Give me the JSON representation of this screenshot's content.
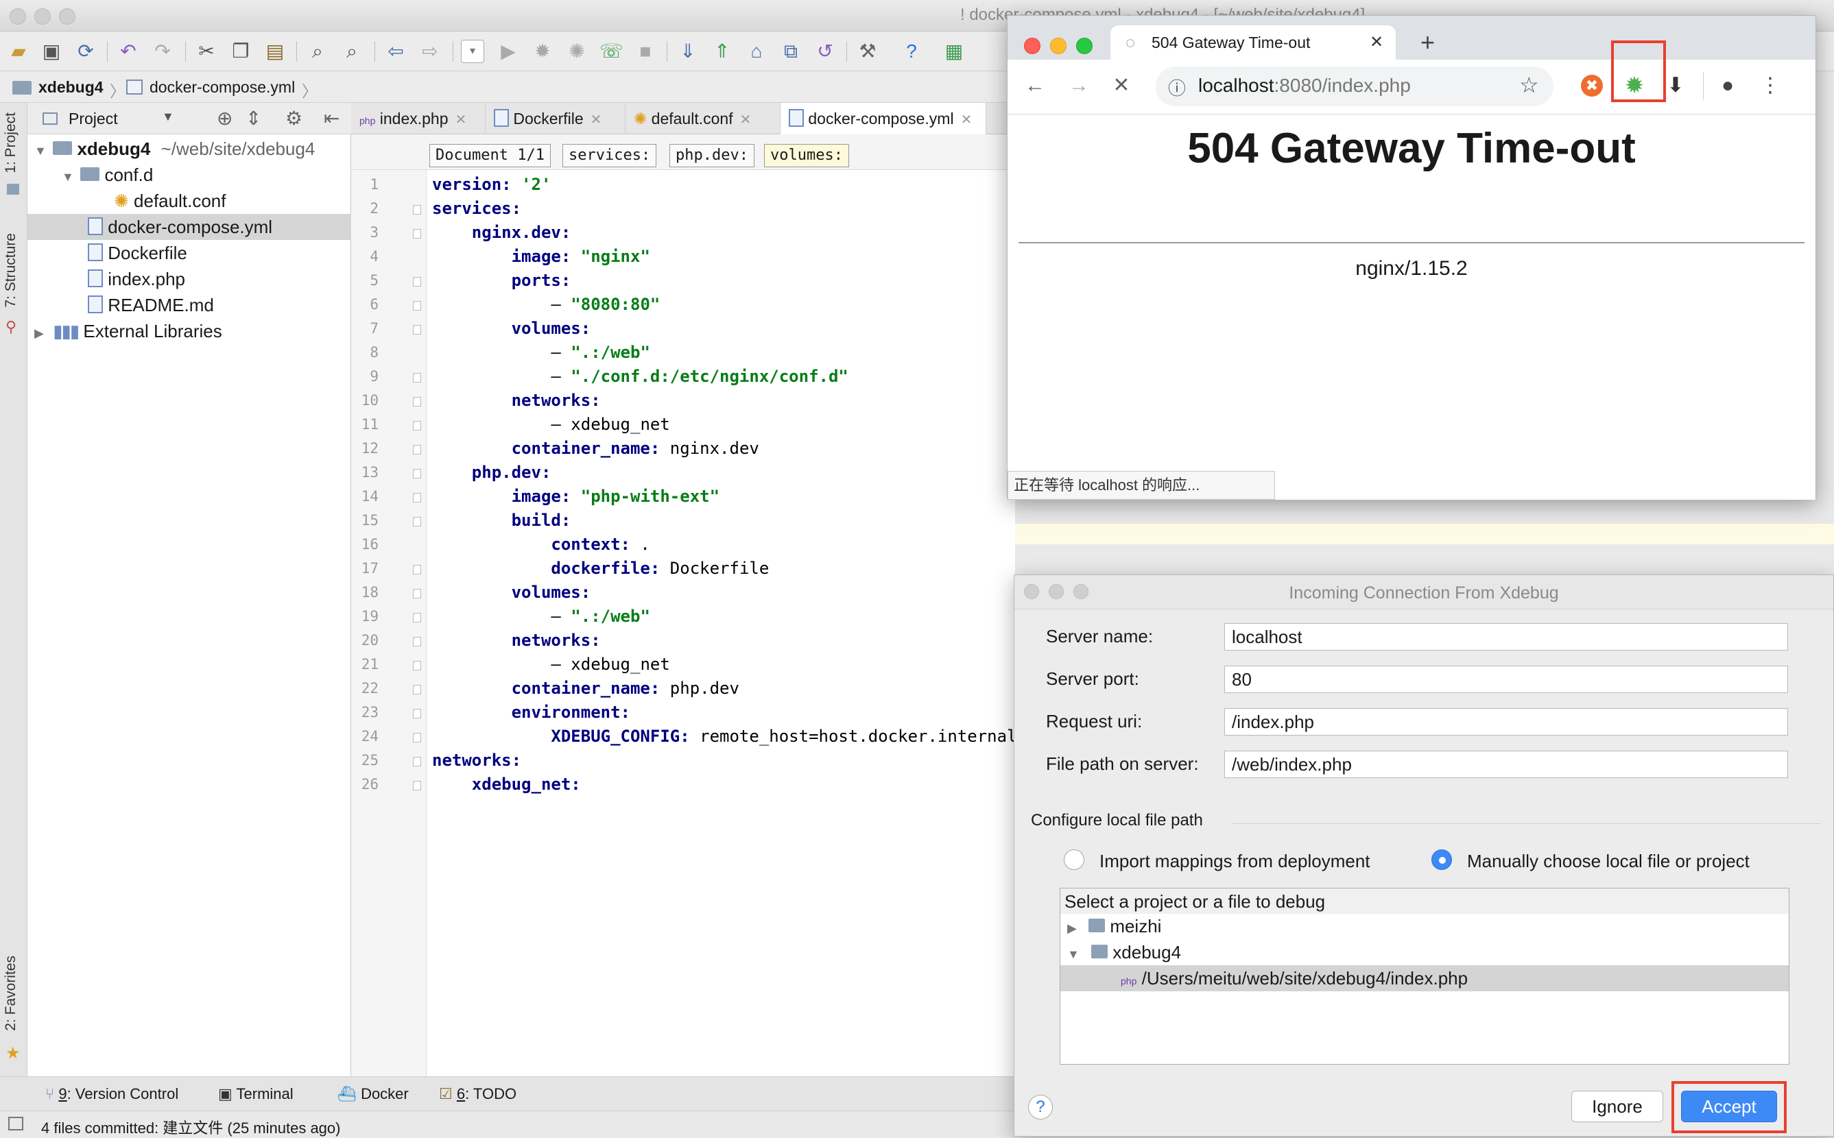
{
  "ide": {
    "window_title": "!   docker-compose.yml - xdebug4 - [~/web/site/xdebug4]",
    "breadcrumb": {
      "project": "xdebug4",
      "file": "docker-compose.yml"
    },
    "left_strip": {
      "project": "1: Project",
      "structure": "7: Structure",
      "favorites": "2: Favorites"
    },
    "project_panel": {
      "header_label": "Project",
      "tree": [
        {
          "name": "xdebug4",
          "path": "~/web/site/xdebug4"
        },
        {
          "name": "conf.d"
        },
        {
          "name": "default.conf"
        },
        {
          "name": "docker-compose.yml"
        },
        {
          "name": "Dockerfile"
        },
        {
          "name": "index.php"
        },
        {
          "name": "README.md"
        },
        {
          "name": "External Libraries"
        }
      ]
    },
    "editor_tabs": [
      "index.php",
      "Dockerfile",
      "default.conf",
      "docker-compose.yml"
    ],
    "yaml_crumbs": [
      "Document 1/1",
      "services:",
      "php.dev:",
      "volumes:"
    ],
    "code_lines": [
      "version: '2'",
      "services:",
      "  nginx.dev:",
      "    image: \"nginx\"",
      "    ports:",
      "      - \"8080:80\"",
      "    volumes:",
      "      - \".:/web\"",
      "      - \"./conf.d:/etc/nginx/conf.d\"",
      "    networks:",
      "      - xdebug_net",
      "    container_name: nginx.dev",
      "  php.dev:",
      "    image: \"php-with-ext\"",
      "    build:",
      "      context: .",
      "      dockerfile: Dockerfile",
      "    volumes:",
      "      - \".:/web\"",
      "    networks:",
      "      - xdebug_net",
      "    container_name: php.dev",
      "    environment:",
      "      XDEBUG_CONFIG: remote_host=host.docker.internal",
      "networks:",
      "  xdebug_net:"
    ],
    "bottom_tools": {
      "vcs_num": "9",
      "vcs": ": Version Control",
      "terminal": "Terminal",
      "docker": "Docker",
      "todo_num": "6",
      "todo": ": TODO"
    },
    "status": "4 files committed: 建立文件 (25 minutes ago)"
  },
  "chrome": {
    "tab_title": "504 Gateway Time-out",
    "url_host": "localhost",
    "url_rest": ":8080/index.php",
    "heading": "504 Gateway Time-out",
    "server": "nginx/1.15.2",
    "status_bubble": "正在等待 localhost 的响应..."
  },
  "dialog": {
    "title": "Incoming Connection From Xdebug",
    "server_name_label": "Server name:",
    "server_name": "localhost",
    "server_port_label": "Server port:",
    "server_port": "80",
    "request_uri_label": "Request uri:",
    "request_uri": "/index.php",
    "file_path_label": "File path on server:",
    "file_path": "/web/index.php",
    "section": "Configure local file path",
    "option_import": "Import mappings from deployment",
    "option_manual": "Manually choose local file or project",
    "select_label": "Select a project or a file to debug",
    "files": [
      "meizhi",
      "xdebug4",
      "/Users/meitu/web/site/xdebug4/index.php"
    ],
    "help": "?",
    "ignore": "Ignore",
    "accept": "Accept"
  },
  "colors": {
    "accent": "#3d8af7",
    "highlight_box": "#e8402f",
    "yaml_key": "#000080",
    "yaml_string": "#067d17"
  }
}
